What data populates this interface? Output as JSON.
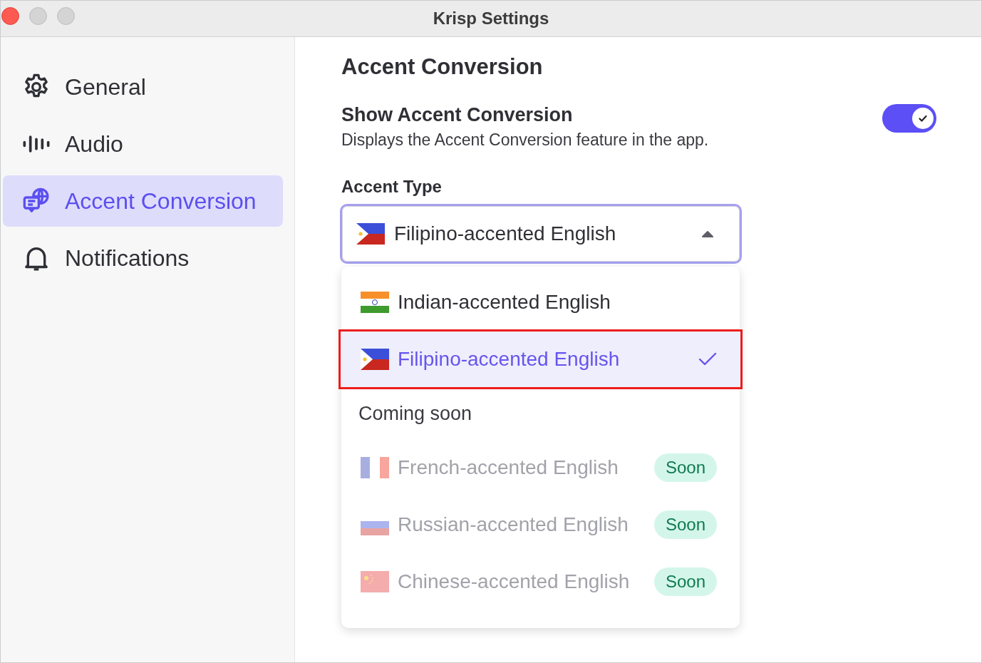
{
  "window": {
    "title": "Krisp Settings"
  },
  "sidebar": {
    "items": [
      {
        "label": "General",
        "selected": false
      },
      {
        "label": "Audio",
        "selected": false
      },
      {
        "label": "Accent Conversion",
        "selected": true
      },
      {
        "label": "Notifications",
        "selected": false
      }
    ]
  },
  "content": {
    "title": "Accent Conversion",
    "setting": {
      "title": "Show Accent Conversion",
      "description": "Displays the Accent Conversion feature in the app.",
      "on": true
    },
    "accent_type": {
      "label": "Accent Type",
      "value": "Filipino-accented English",
      "expanded": true,
      "options": [
        {
          "label": "Indian-accented English",
          "kind": "india",
          "selected": false,
          "highlighted": false
        },
        {
          "label": "Filipino-accented English",
          "kind": "philippines",
          "selected": true,
          "highlighted": true
        }
      ],
      "section_label": "Coming soon",
      "coming_soon": [
        {
          "label": "French-accented English",
          "kind": "france",
          "disabled": true,
          "badge": "Soon"
        },
        {
          "label": "Russian-accented English",
          "kind": "russia",
          "disabled": true,
          "badge": "Soon"
        },
        {
          "label": "Chinese-accented English",
          "kind": "china",
          "disabled": true,
          "badge": "Soon"
        }
      ]
    }
  }
}
